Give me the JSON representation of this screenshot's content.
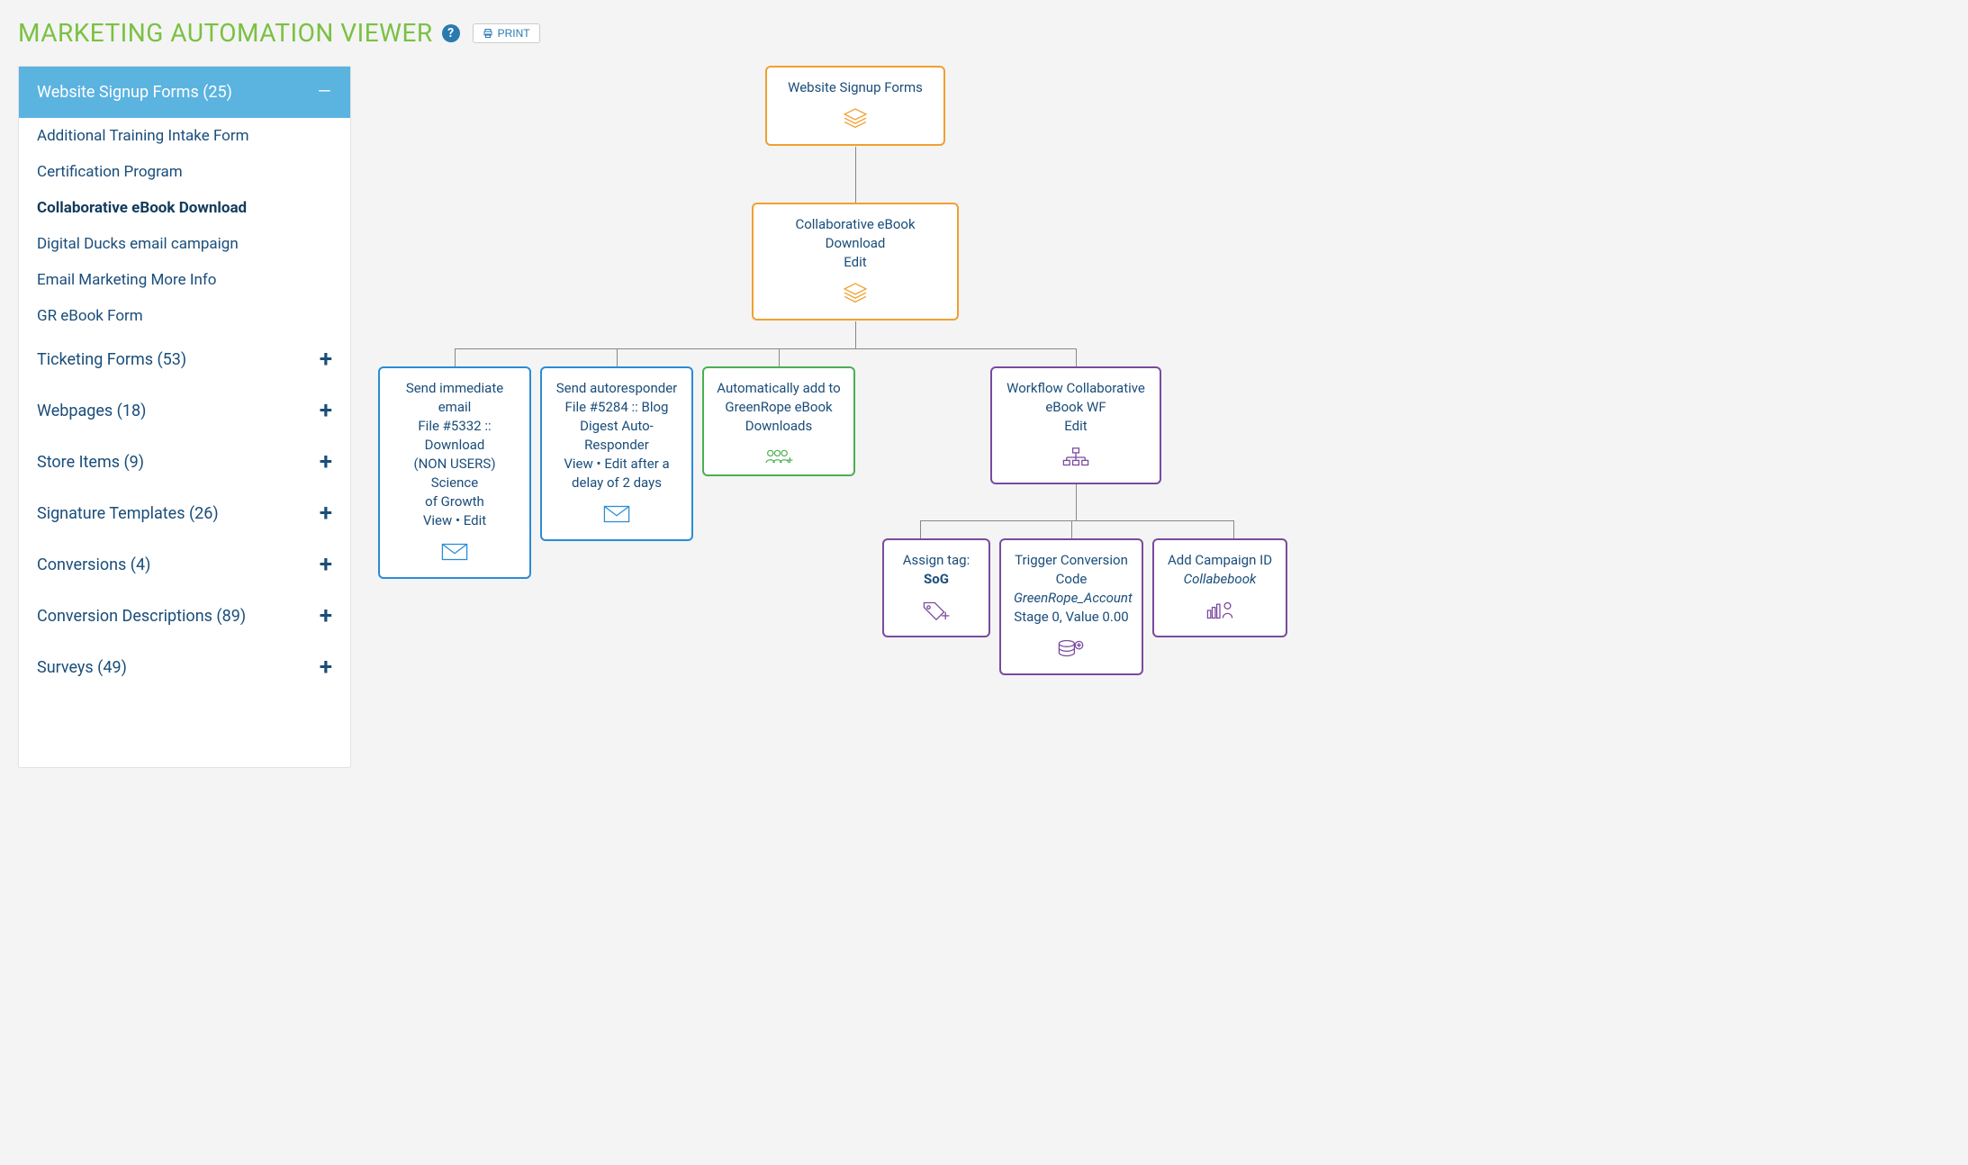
{
  "header": {
    "title": "MARKETING AUTOMATION VIEWER",
    "help_tooltip": "?",
    "print_label": "PRINT"
  },
  "sidebar": {
    "sections": [
      {
        "label": "Website Signup Forms",
        "count": 25,
        "expanded": true,
        "items": [
          {
            "label": "Additional Training Intake Form",
            "active": false
          },
          {
            "label": "Certification Program",
            "active": false
          },
          {
            "label": "Collaborative eBook Download",
            "active": true
          },
          {
            "label": "Digital Ducks email campaign",
            "active": false
          },
          {
            "label": "Email Marketing More Info",
            "active": false
          },
          {
            "label": "GR eBook Form",
            "active": false
          }
        ]
      },
      {
        "label": "Ticketing Forms",
        "count": 53,
        "expanded": false
      },
      {
        "label": "Webpages",
        "count": 18,
        "expanded": false
      },
      {
        "label": "Store Items",
        "count": 9,
        "expanded": false
      },
      {
        "label": "Signature Templates",
        "count": 26,
        "expanded": false
      },
      {
        "label": "Conversions",
        "count": 4,
        "expanded": false
      },
      {
        "label": "Conversion Descriptions",
        "count": 89,
        "expanded": false
      },
      {
        "label": "Surveys",
        "count": 49,
        "expanded": false
      }
    ]
  },
  "diagram": {
    "root": {
      "title": "Website Signup Forms",
      "icon": "stack"
    },
    "level1": {
      "title": "Collaborative eBook Download",
      "edit": "Edit",
      "icon": "stack"
    },
    "level2": [
      {
        "color": "blue",
        "lines": [
          "Send immediate email",
          "File #5332 :: Download",
          "(NON USERS) Science",
          "of Growth"
        ],
        "actions": {
          "view": "View",
          "edit": "Edit"
        },
        "icon": "envelope"
      },
      {
        "color": "blue",
        "lines": [
          "Send autoresponder",
          "File #5284 :: Blog",
          "Digest Auto-Responder"
        ],
        "actions": {
          "view": "View",
          "edit": "Edit"
        },
        "trailing": " after a delay of 2 days",
        "icon": "envelope"
      },
      {
        "color": "green",
        "lines": [
          "Automatically add to",
          "GreenRope eBook",
          "Downloads"
        ],
        "icon": "group-plus"
      },
      {
        "color": "purple",
        "lines": [
          "Workflow Collaborative",
          "eBook WF"
        ],
        "actions": {
          "edit": "Edit"
        },
        "icon": "org"
      }
    ],
    "level3": [
      {
        "color": "purple",
        "prefix": "Assign tag: ",
        "bold": "SoG",
        "icon": "tag-plus"
      },
      {
        "color": "purple",
        "lines": [
          "Trigger Conversion",
          "Code"
        ],
        "italic": "GreenRope_Account",
        "sub": "Stage 0, Value 0.00",
        "icon": "coins"
      },
      {
        "color": "purple",
        "lines": [
          "Add Campaign ID"
        ],
        "italic": "Collabebook",
        "icon": "people-chart"
      }
    ]
  },
  "colors": {
    "orange": "#f0a030",
    "blue": "#2a8cd6",
    "green": "#4caf50",
    "purple": "#7a4a9e"
  }
}
